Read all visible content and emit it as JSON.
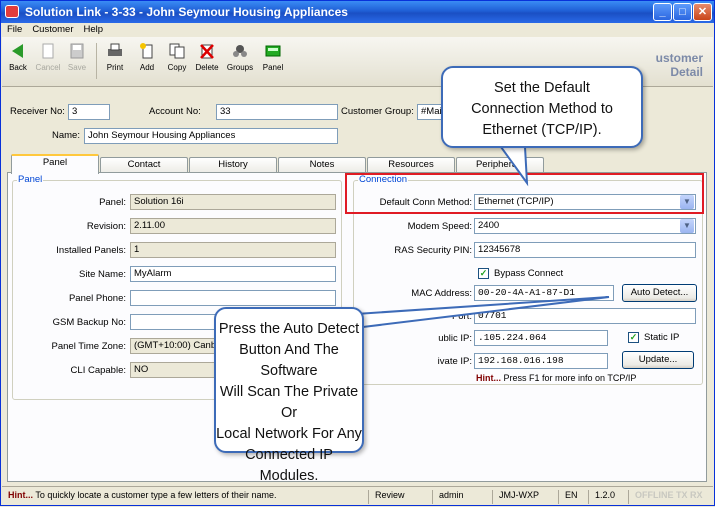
{
  "window": {
    "title": "Solution Link - 3-33 - John Seymour Housing Appliances"
  },
  "menu": [
    "File",
    "Customer",
    "Help"
  ],
  "toolbar": {
    "back": "Back",
    "cancel": "Cancel",
    "save": "Save",
    "print": "Print",
    "add": "Add",
    "copy": "Copy",
    "delete": "Delete",
    "groups": "Groups",
    "panel": "Panel",
    "customer_detail_1": "ustomer",
    "customer_detail_2": "Detail"
  },
  "header": {
    "receiver_label": "Receiver No:",
    "receiver_value": "3",
    "account_label": "Account No:",
    "account_value": "33",
    "group_label": "Customer Group:",
    "group_value": "#Mai",
    "name_label": "Name:",
    "name_value": "John Seymour Housing Appliances"
  },
  "tabs": [
    "Panel",
    "Contact",
    "History",
    "Notes",
    "Resources",
    "Peripherals"
  ],
  "panel_group": {
    "title": "Panel",
    "fields": [
      {
        "label": "Panel:",
        "value": "Solution 16i"
      },
      {
        "label": "Revision:",
        "value": "2.11.00"
      },
      {
        "label": "Installed Panels:",
        "value": "1"
      },
      {
        "label": "Site Name:",
        "value": "MyAlarm"
      },
      {
        "label": "Panel Phone:",
        "value": ""
      },
      {
        "label": "GSM Backup No:",
        "value": ""
      },
      {
        "label": "Panel Time Zone:",
        "value": "(GMT+10:00) Canb"
      },
      {
        "label": "CLI Capable:",
        "value": "NO"
      }
    ]
  },
  "connection_group": {
    "title": "Connection",
    "default_conn_label": "Default Conn Method:",
    "default_conn_value": "Ethernet (TCP/IP)",
    "modem_speed_label": "Modem Speed:",
    "modem_speed_value": "2400",
    "ras_pin_label": "RAS Security PIN:",
    "ras_pin_value": "12345678",
    "bypass_label": "Bypass Connect",
    "bypass_checked": true,
    "mac_label": "MAC Address:",
    "mac_value": "00-20-4A-A1-87-D1",
    "auto_detect": "Auto Detect...",
    "port_label": "Port:",
    "port_value": "07701",
    "public_ip_label": "ublic IP:",
    "public_ip_value": ".105.224.064",
    "static_ip_label": "Static IP",
    "static_ip_checked": true,
    "private_ip_label": "ivate IP:",
    "private_ip_value": "192.168.016.198",
    "update": "Update...",
    "hint_bold": "Hint...",
    "hint_text": "Press F1 for more info on TCP/IP"
  },
  "callouts": {
    "top": [
      "Set the Default",
      "Connection Method to",
      "Ethernet (TCP/IP)."
    ],
    "bottom": [
      "Press the Auto Detect",
      "Button And The Software",
      "Will Scan The Private Or",
      "Local Network For Any",
      "Connected IP Modules."
    ]
  },
  "status": {
    "hint_bold": "Hint...",
    "hint_text": "To quickly locate a customer type a few letters of their name.",
    "review": "Review",
    "user": "admin",
    "machine": "JMJ-WXP",
    "lang": "EN",
    "version": "1.2.0",
    "offline": "OFFLINE",
    "tx": "TX",
    "rx": "RX"
  },
  "colors": {
    "title_bar": "#1f5fd6",
    "highlight_box": "#e01b24",
    "callout_border": "#3d6bb8",
    "hint": "#800000"
  }
}
